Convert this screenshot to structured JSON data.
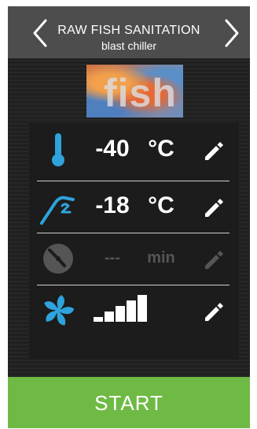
{
  "header": {
    "title": "RAW FISH SANITATION",
    "subtitle": "blast chiller",
    "prev_icon": "chevron-left-icon",
    "next_icon": "chevron-right-icon"
  },
  "thumbnail": {
    "word": "fish"
  },
  "settings": {
    "core_temp": {
      "icon": "thermometer-icon",
      "value": "-40",
      "unit": "°C",
      "edit_icon": "pencil-icon"
    },
    "probe_temp": {
      "icon": "core-probe-icon",
      "value": "-18",
      "unit": "°C",
      "edit_icon": "pencil-icon"
    },
    "time": {
      "icon": "clock-icon",
      "value": "---",
      "unit": "min",
      "edit_icon": "pencil-icon",
      "enabled": false
    },
    "fan": {
      "icon": "fan-icon",
      "level": 5,
      "max_level": 5,
      "edit_icon": "pencil-icon"
    }
  },
  "start_label": "START",
  "colors": {
    "accent_blue": "#2ea3dc",
    "start_green": "#6fba44",
    "header_gray": "#4d4d4d",
    "disabled_gray": "#555555"
  }
}
